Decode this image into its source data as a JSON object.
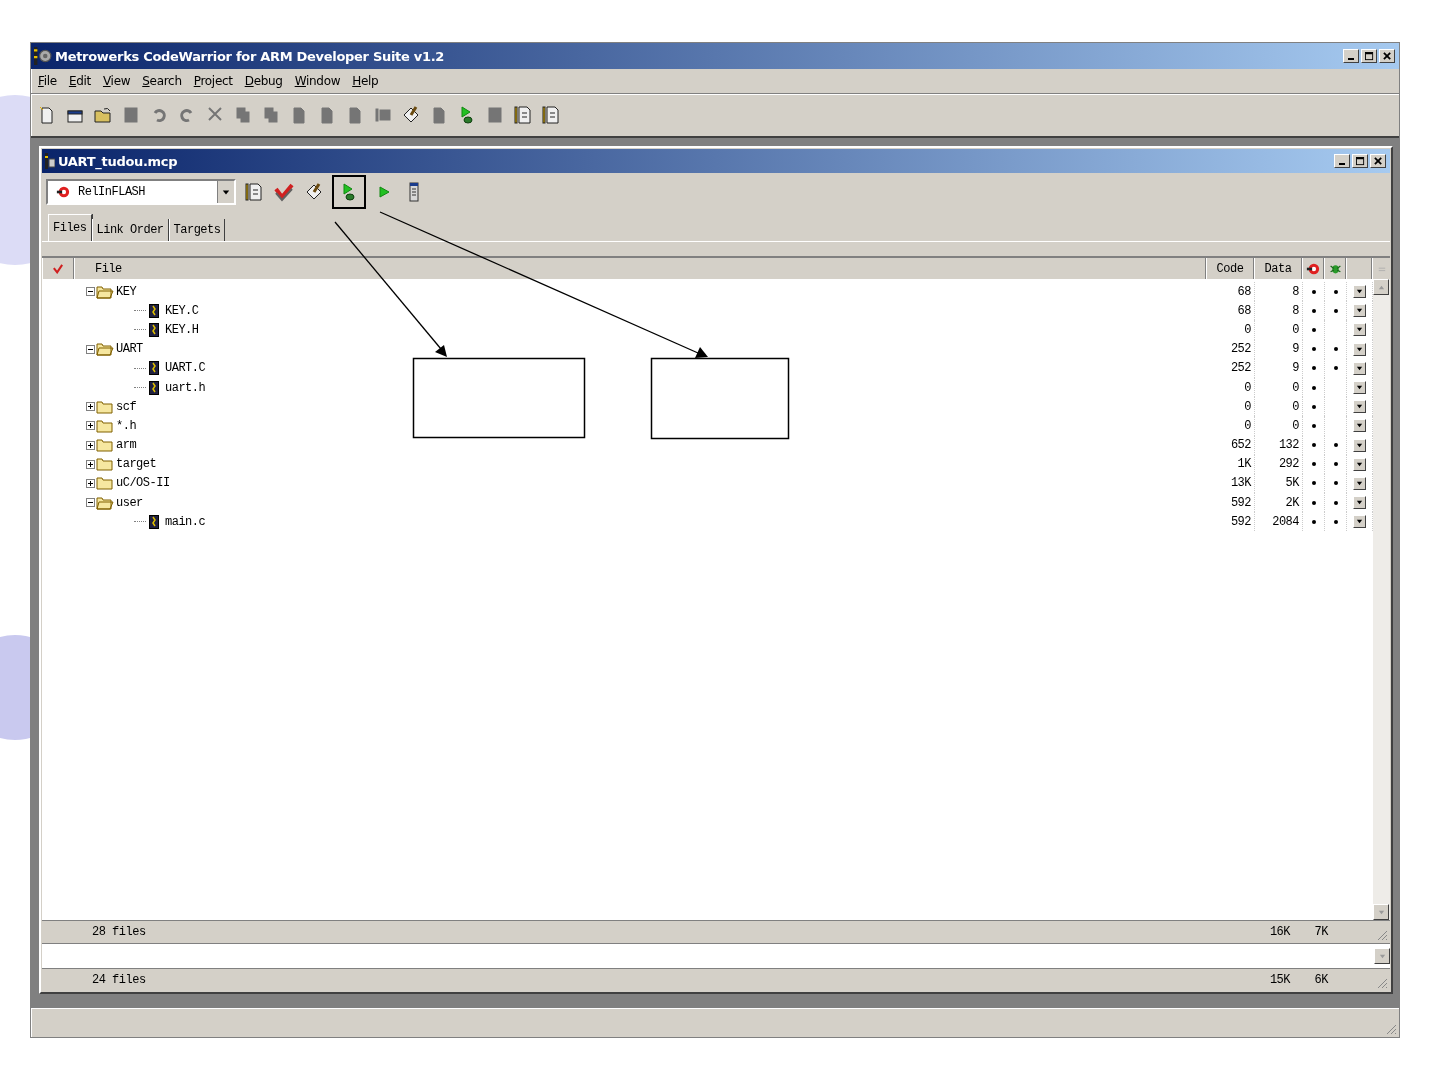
{
  "window": {
    "title": "Metrowerks CodeWarrior for ARM Developer Suite v1.2"
  },
  "menu": [
    "File",
    "Edit",
    "View",
    "Search",
    "Project",
    "Debug",
    "Window",
    "Help"
  ],
  "toolbar": [
    {
      "kind": "new-file",
      "disabled": false
    },
    {
      "kind": "new-project",
      "disabled": false
    },
    {
      "kind": "open",
      "disabled": false
    },
    {
      "kind": "save",
      "disabled": true
    },
    {
      "kind": "undo",
      "disabled": true
    },
    {
      "kind": "redo",
      "disabled": true
    },
    {
      "kind": "cut",
      "disabled": true
    },
    {
      "kind": "copy",
      "disabled": true
    },
    {
      "kind": "paste",
      "disabled": true
    },
    {
      "kind": "document",
      "disabled": true
    },
    {
      "kind": "document",
      "disabled": true
    },
    {
      "kind": "document",
      "disabled": true
    },
    {
      "kind": "panel",
      "disabled": true
    },
    {
      "kind": "brush",
      "disabled": false
    },
    {
      "kind": "document",
      "disabled": true
    },
    {
      "kind": "debug",
      "disabled": false
    },
    {
      "kind": "save",
      "disabled": true
    },
    {
      "kind": "list",
      "disabled": false
    },
    {
      "kind": "list",
      "disabled": false
    }
  ],
  "project": {
    "title": "UART_tudou.mcp",
    "target": "RelInFLASH",
    "toolbar": [
      {
        "kind": "list",
        "highlighted": false
      },
      {
        "kind": "make",
        "highlighted": false
      },
      {
        "kind": "brush",
        "highlighted": false
      },
      {
        "kind": "debug",
        "highlighted": true
      },
      {
        "kind": "run",
        "highlighted": false
      },
      {
        "kind": "panel-column",
        "highlighted": false
      }
    ],
    "tabs": [
      {
        "label": "Files",
        "selected": true
      },
      {
        "label": "Link Order",
        "selected": false
      },
      {
        "label": "Targets",
        "selected": false
      }
    ],
    "columns": [
      "File",
      "Code",
      "Data"
    ],
    "files": [
      {
        "name": "KEY",
        "kind": "group",
        "expanded": true,
        "code": "68",
        "data": "8",
        "debug": true,
        "target": true,
        "children": [
          {
            "name": "KEY.C",
            "kind": "file",
            "code": "68",
            "data": "8",
            "debug": true,
            "target": true
          },
          {
            "name": "KEY.H",
            "kind": "file",
            "code": "0",
            "data": "0",
            "debug": true,
            "target": false
          }
        ]
      },
      {
        "name": "UART",
        "kind": "group",
        "expanded": true,
        "code": "252",
        "data": "9",
        "debug": true,
        "target": true,
        "children": [
          {
            "name": "UART.C",
            "kind": "file",
            "code": "252",
            "data": "9",
            "debug": true,
            "target": true
          },
          {
            "name": "uart.h",
            "kind": "file",
            "code": "0",
            "data": "0",
            "debug": true,
            "target": false
          }
        ]
      },
      {
        "name": "scf",
        "kind": "group",
        "expanded": false,
        "code": "0",
        "data": "0",
        "debug": true,
        "target": false
      },
      {
        "name": "*.h",
        "kind": "group",
        "expanded": false,
        "code": "0",
        "data": "0",
        "debug": true,
        "target": false
      },
      {
        "name": "arm",
        "kind": "group",
        "expanded": false,
        "code": "652",
        "data": "132",
        "debug": true,
        "target": true
      },
      {
        "name": "target",
        "kind": "group",
        "expanded": false,
        "code": "1K",
        "data": "292",
        "debug": true,
        "target": true
      },
      {
        "name": "uC/OS-II",
        "kind": "group",
        "expanded": false,
        "code": "13K",
        "data": "5K",
        "debug": true,
        "target": true
      },
      {
        "name": "user",
        "kind": "group",
        "expanded": true,
        "code": "592",
        "data": "2K",
        "debug": true,
        "target": true,
        "children": [
          {
            "name": "main.c",
            "kind": "file",
            "code": "592",
            "data": "2084",
            "debug": true,
            "target": true
          }
        ]
      }
    ],
    "totals": [
      {
        "label": "28 files",
        "code": "16K",
        "data": "7K"
      },
      {
        "label": "24 files",
        "code": "15K",
        "data": "6K"
      }
    ]
  }
}
